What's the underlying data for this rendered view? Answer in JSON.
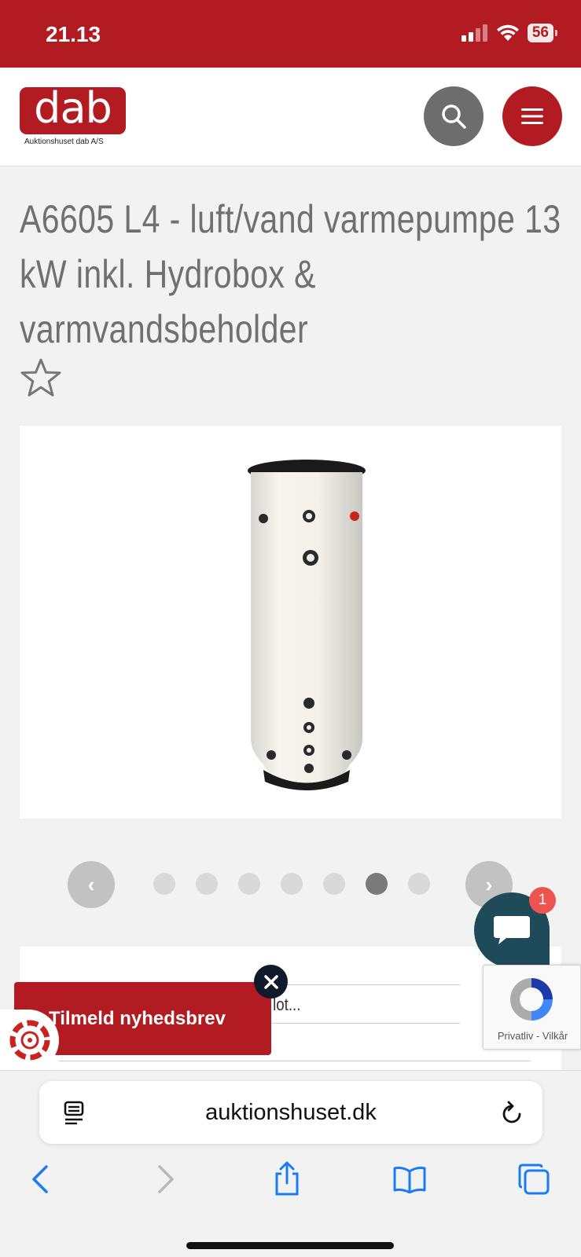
{
  "status_bar": {
    "time": "21.13",
    "battery": "56",
    "bar_color": "#b31b22"
  },
  "header": {
    "logo_text": "dab",
    "logo_subtitle": "Auktionshuset dab A/S",
    "search_icon": "search-icon",
    "menu_icon": "hamburger-menu-icon",
    "brand_color": "#b31b22"
  },
  "lot": {
    "title": "A6605 L4 - luft/vand varmepumpe 13 kW inkl. Hydrobox & varmvandsbeholder",
    "favorite_icon": "star-outline-icon"
  },
  "carousel": {
    "prev_label": "‹",
    "next_label": "›",
    "slide_count": 7,
    "active_index": 5
  },
  "lot_search": {
    "placeholder_partial": "efter lot..."
  },
  "newsletter": {
    "label": "Tilmeld nyhedsbrev",
    "close_icon": "close-icon"
  },
  "chat": {
    "badge_count": "1",
    "icon": "chat-bubble-icon"
  },
  "recaptcha": {
    "links": "Privatliv - Vilkår"
  },
  "browser": {
    "url": "auktionshuset.dk",
    "reader_icon": "reader-mode-icon",
    "reload_icon": "reload-icon",
    "toolbar_icons": [
      "back-icon",
      "forward-icon",
      "share-icon",
      "bookmarks-icon",
      "tabs-icon"
    ]
  }
}
